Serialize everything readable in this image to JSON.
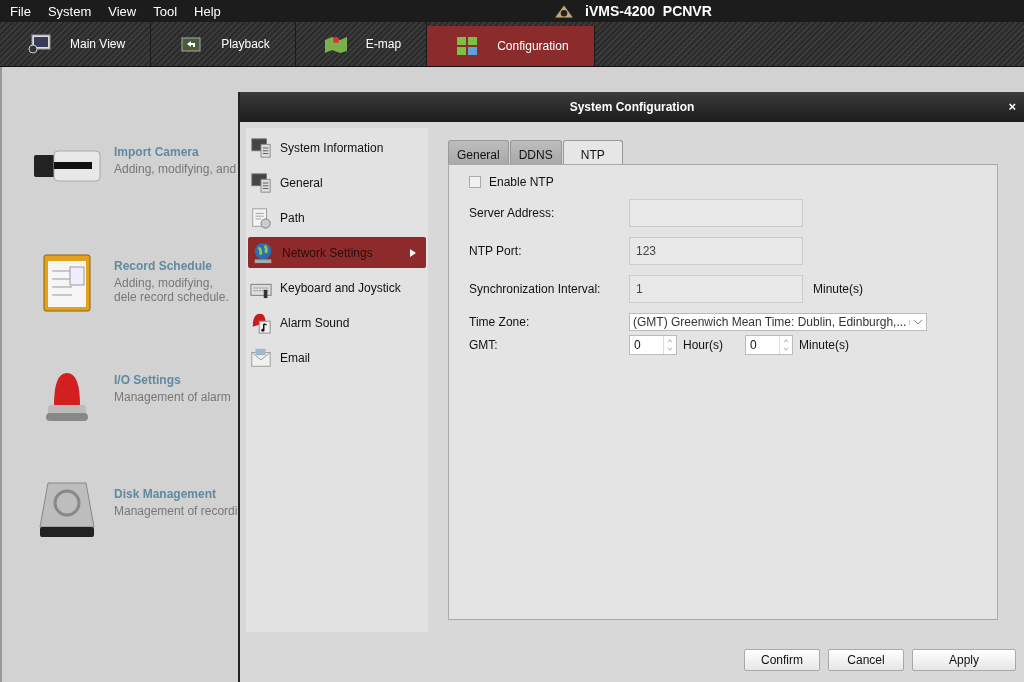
{
  "menu": [
    "File",
    "System",
    "View",
    "Tool",
    "Help"
  ],
  "app_title": "iVMS-4200  PCNVR",
  "toolbar": [
    {
      "label": "Main View",
      "selected": false
    },
    {
      "label": "Playback",
      "selected": false
    },
    {
      "label": "E-map",
      "selected": false
    },
    {
      "label": "Configuration",
      "selected": true
    }
  ],
  "modules": [
    {
      "title": "Import Camera",
      "description": "Adding, modifying, and"
    },
    {
      "title": "Record Schedule",
      "description": "Adding, modifying, dele record schedule."
    },
    {
      "title": "I/O Settings",
      "description": "Management of alarm"
    },
    {
      "title": "Disk Management",
      "description": "Management of recordi"
    }
  ],
  "dialog": {
    "title": "System Configuration",
    "close": "×",
    "nav": [
      {
        "label": "System Information",
        "selected": false
      },
      {
        "label": "General",
        "selected": false
      },
      {
        "label": "Path",
        "selected": false
      },
      {
        "label": "Network Settings",
        "selected": true
      },
      {
        "label": "Keyboard and Joystick",
        "selected": false
      },
      {
        "label": "Alarm Sound",
        "selected": false
      },
      {
        "label": "Email",
        "selected": false
      }
    ],
    "tabs": [
      {
        "label": "General",
        "selected": false
      },
      {
        "label": "DDNS",
        "selected": false
      },
      {
        "label": "NTP",
        "selected": true
      }
    ],
    "enable_ntp": {
      "label": "Enable NTP",
      "checked": false
    },
    "fields": [
      {
        "kind": "text",
        "label": "Server Address:",
        "disabled": true
      },
      {
        "kind": "text",
        "label": "NTP Port:",
        "value": "123",
        "disabled": true
      },
      {
        "kind": "text",
        "label": "Synchronization Interval:",
        "value": "1",
        "unit": "Minute(s)",
        "disabled": true
      },
      {
        "kind": "select",
        "label": "Time Zone:",
        "value": "(GMT) Greenwich Mean Time: Dublin, Edinburgh,..."
      },
      {
        "kind": "spin",
        "label": "GMT:",
        "spinners": [
          {
            "value": "0",
            "unit": "Hour(s)"
          },
          {
            "value": "0",
            "unit": "Minute(s)"
          }
        ]
      }
    ],
    "buttons": [
      "Confirm",
      "Cancel",
      "Apply"
    ]
  }
}
